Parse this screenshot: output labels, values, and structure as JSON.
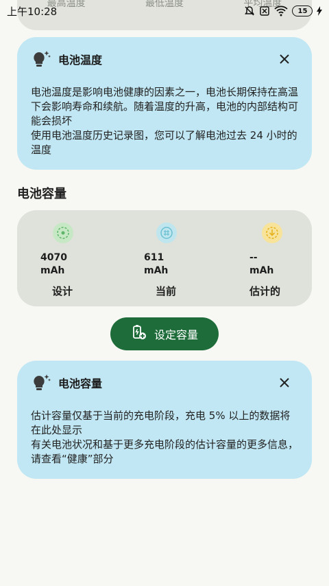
{
  "status_bar": {
    "time": "上午10:28",
    "battery": "15"
  },
  "previous_card": {
    "labels": [
      "最高温度",
      "最低温度",
      "平均温度"
    ]
  },
  "temp_card": {
    "title": "电池温度",
    "body": "电池温度是影响电池健康的因素之一，电池长期保持在高温下会影响寿命和续航。随着温度的升高，电池的内部结构可能会损坏\n使用电池温度历史记录图，您可以了解电池过去 24 小时的温度"
  },
  "capacity_section": {
    "title": "电池容量",
    "items": [
      {
        "value": "4070",
        "unit": "mAh",
        "label": "设计",
        "icon": "design-capacity-icon",
        "color": "#7cc47f"
      },
      {
        "value": "611",
        "unit": "mAh",
        "label": "当前",
        "icon": "current-capacity-icon",
        "color": "#7dc9d8"
      },
      {
        "value": "--",
        "unit": "mAh",
        "label": "估计的",
        "icon": "estimated-capacity-icon",
        "color": "#f1c232"
      }
    ]
  },
  "set_capacity_button": {
    "label": "设定容量"
  },
  "capacity_card": {
    "title": "电池容量",
    "body": "估计容量仅基于当前的充电阶段，充电 5% 以上的数据将在此处显示\n有关电池状况和基于更多充电阶段的估计容量的更多信息，请查看“健康”部分"
  },
  "colors": {
    "background": "#f7f8f3",
    "info_card": "#c0e7f3",
    "capacity_card": "#dfe2da",
    "button": "#1d6c3a"
  }
}
